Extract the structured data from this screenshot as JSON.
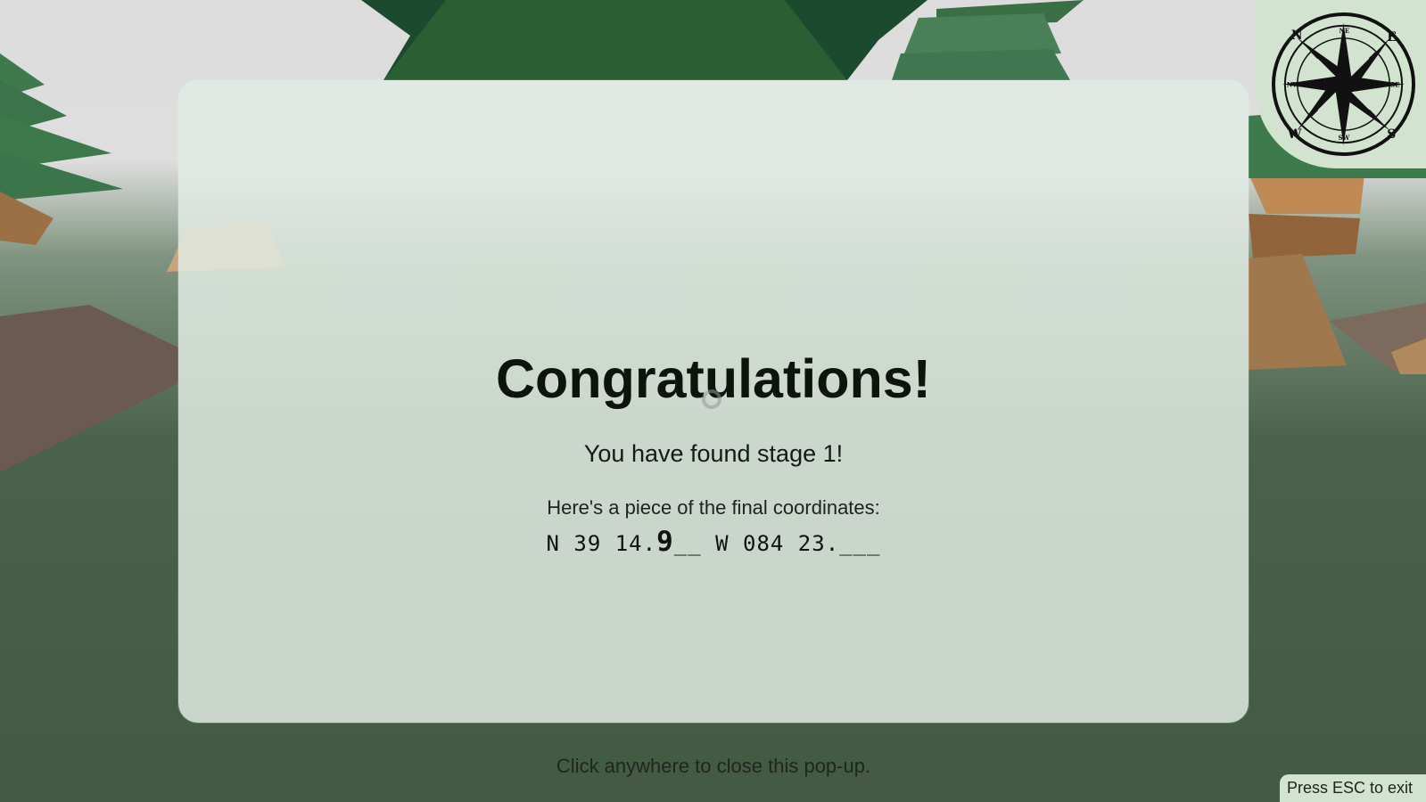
{
  "popup": {
    "title": "Congratulations!",
    "stage_text": "You have found stage 1!",
    "piece_text": "Here's a piece of the final coordinates:",
    "coords_part1": "N 39 14.",
    "coords_highlight": "9",
    "coords_part2": "__ W 084 23.___",
    "close_hint": "Click anywhere to close this pop-up."
  },
  "compass": {
    "icon": "compass-rose-icon",
    "letters": [
      "N",
      "E",
      "S",
      "W",
      "NE",
      "SE",
      "SW",
      "NW"
    ]
  },
  "footer": {
    "esc_hint": "Press ESC to exit"
  },
  "colors": {
    "sky": "#dedede",
    "ground": "#435a42",
    "tree": "#2a5e33",
    "popup_bg": "#e2ebe4",
    "badge_bg": "#d2e3d0"
  }
}
